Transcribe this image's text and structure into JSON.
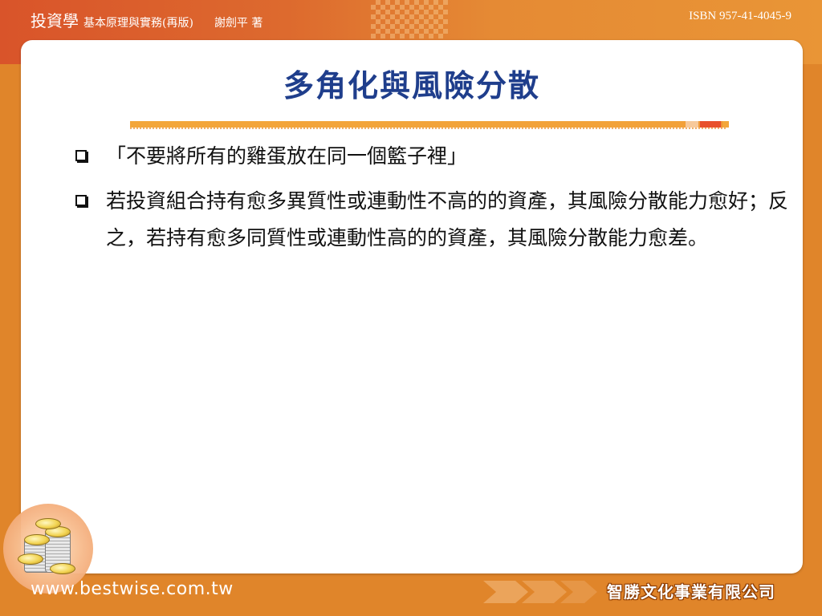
{
  "header": {
    "book_name": "投資學",
    "book_subtitle": "基本原理與實務(再版)",
    "author": "謝劍平 著",
    "isbn": "ISBN 957-41-4045-9"
  },
  "slide": {
    "title": "多角化與風險分散",
    "bullets": [
      {
        "text": "「不要將所有的雞蛋放在同一個籃子裡」"
      },
      {
        "text": "若投資組合持有愈多異質性或連動性不高的的資產，其風險分散能力愈好；反之，若持有愈多同質性或連動性高的的資產，其風險分散能力愈差。"
      }
    ]
  },
  "footer": {
    "url": "www.bestwise.com.tw",
    "company": "智勝文化事業有限公司"
  },
  "colors": {
    "accent_orange": "#e0852a",
    "header_red": "#d9542a",
    "title_blue": "#1f3e8c",
    "rule_orange": "#f3a63a",
    "rule_red": "#e8502a"
  },
  "icons": {
    "bullet": "checkbox-square-icon",
    "decoration": "coins-icon",
    "footer_arrows": "arrow-right-icon"
  }
}
